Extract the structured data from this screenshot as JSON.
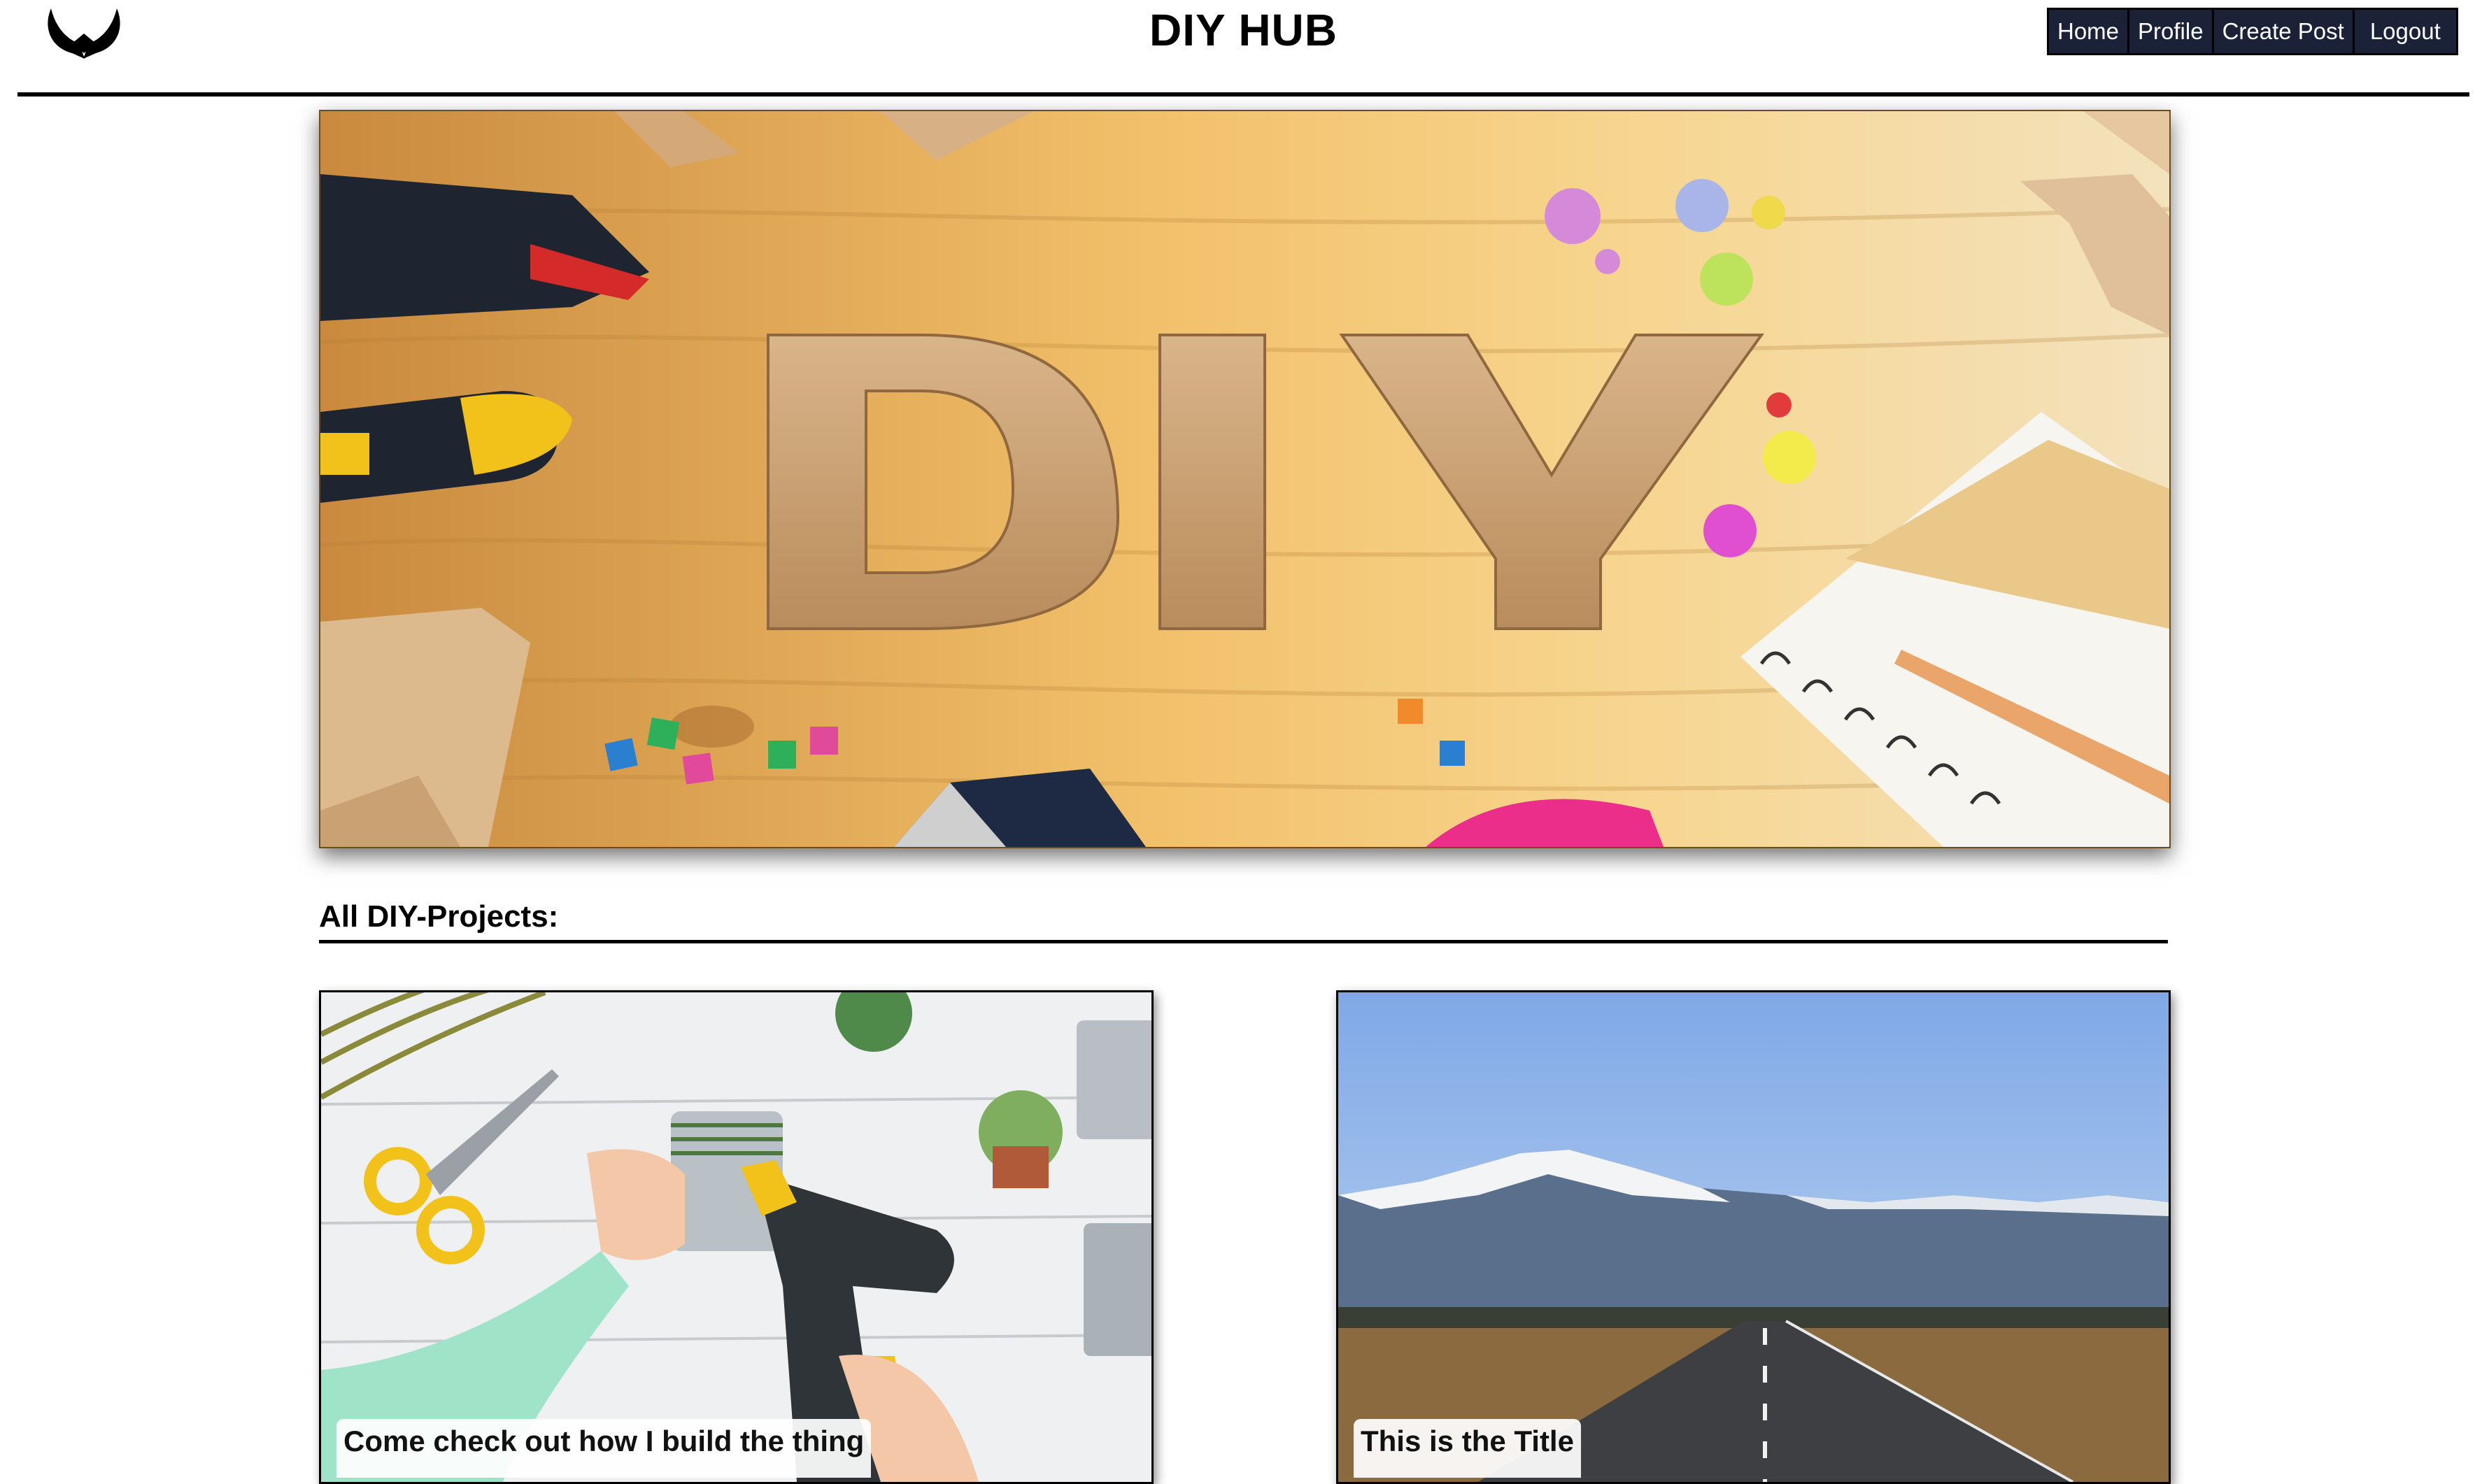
{
  "header": {
    "logo_icon": "horns-logo-icon",
    "title": "DIY HUB",
    "nav": {
      "home": "Home",
      "profile": "Profile",
      "create_post": "Create Post",
      "logout": "Logout"
    }
  },
  "hero": {
    "banner_text": "DIY"
  },
  "projects": {
    "section_title": "All DIY-Projects:",
    "cards": [
      {
        "title": "Come check out how I build the thing"
      },
      {
        "title": "This is the Title"
      }
    ]
  },
  "colors": {
    "nav_background": "#1b2238",
    "page_background": "#ffffff",
    "text": "#000000"
  }
}
